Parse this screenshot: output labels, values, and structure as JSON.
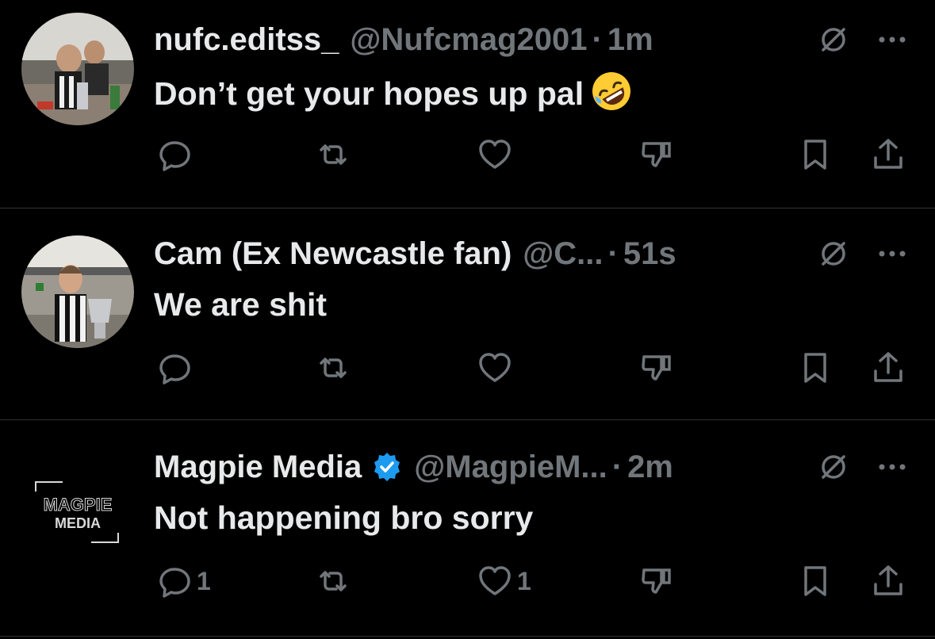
{
  "tweets": [
    {
      "name": "nufc.editss_",
      "handle": "@Nufcmag2001",
      "separator": "·",
      "time": "1m",
      "text": "Don’t get your hopes up pal",
      "emoji": "rolling-on-floor-laughing",
      "verified": false,
      "reply_count": "",
      "repost_count": "",
      "like_count": "",
      "avatar": "photo-trophy-celebration"
    },
    {
      "name": "Cam (Ex Newcastle fan)",
      "handle": "@C...",
      "separator": "·",
      "time": "51s",
      "text": "We are shit",
      "verified": false,
      "reply_count": "",
      "repost_count": "",
      "like_count": "",
      "avatar": "photo-player-with-trophy"
    },
    {
      "name": "Magpie Media",
      "handle": "@MagpieM...",
      "separator": "·",
      "time": "2m",
      "text": "Not happening bro sorry",
      "verified": true,
      "reply_count": "1",
      "repost_count": "",
      "like_count": "1",
      "avatar": "logo",
      "avatar_logo_line1": "MAGPIE",
      "avatar_logo_line2": "MEDIA"
    }
  ],
  "colors": {
    "background": "#000000",
    "text_primary": "#e7e9ea",
    "text_secondary": "#71767b",
    "divider": "#2f3336",
    "verified_blue": "#1d9bf0"
  }
}
